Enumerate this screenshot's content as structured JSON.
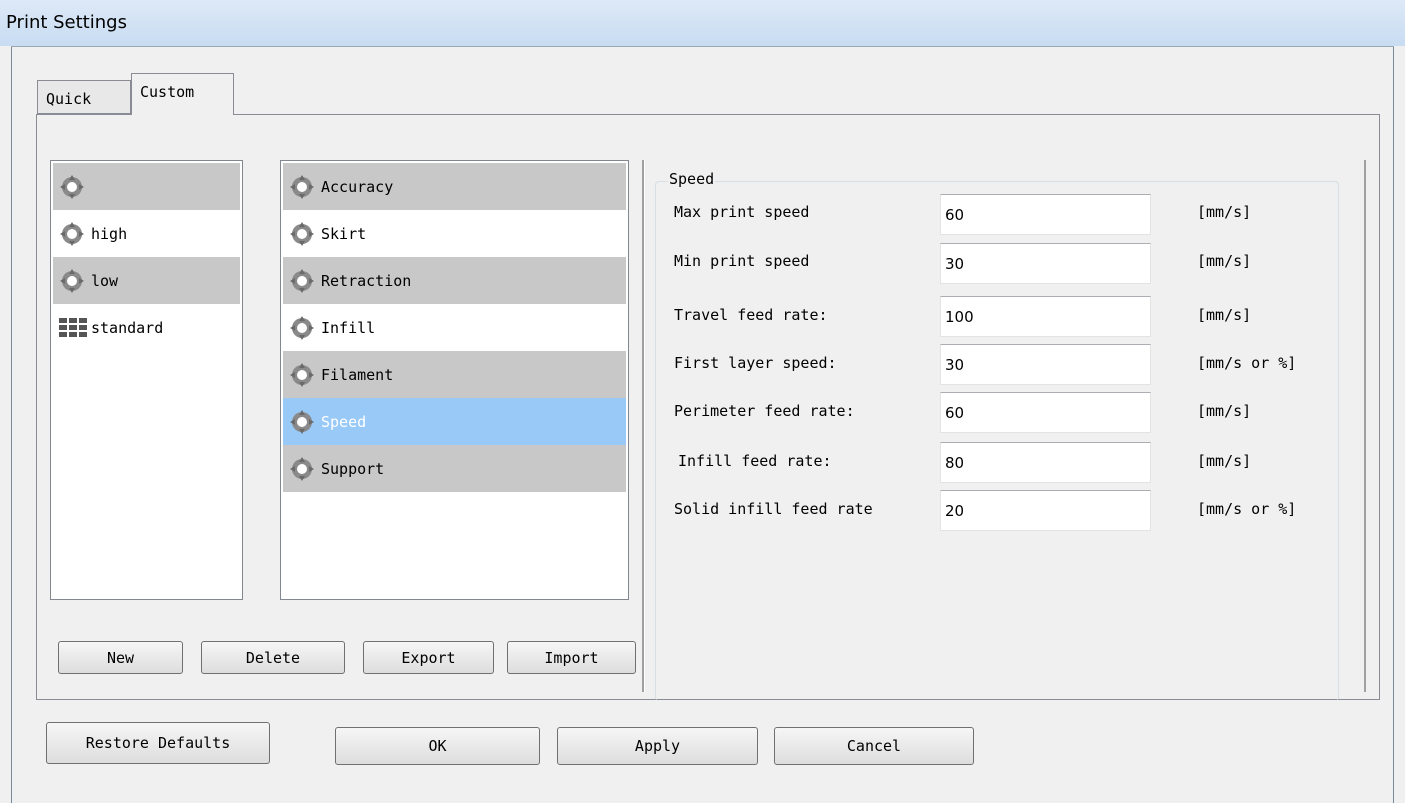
{
  "window": {
    "title": "Print Settings"
  },
  "tabs": [
    {
      "label": "Quick",
      "active": false
    },
    {
      "label": "Custom",
      "active": true
    }
  ],
  "profiles": {
    "items": [
      {
        "label": "",
        "icon": "gear-cross-icon",
        "shaded": true
      },
      {
        "label": "high",
        "icon": "gear-cross-icon",
        "shaded": false
      },
      {
        "label": "low",
        "icon": "gear-cross-icon",
        "shaded": true
      },
      {
        "label": "standard",
        "icon": "grid-icon",
        "shaded": false
      }
    ]
  },
  "categories": {
    "items": [
      {
        "label": "Accuracy",
        "shaded": true,
        "selected": false
      },
      {
        "label": "Skirt",
        "shaded": false,
        "selected": false
      },
      {
        "label": "Retraction",
        "shaded": true,
        "selected": false
      },
      {
        "label": "Infill",
        "shaded": false,
        "selected": false
      },
      {
        "label": "Filament",
        "shaded": true,
        "selected": false
      },
      {
        "label": "Speed",
        "shaded": false,
        "selected": true
      },
      {
        "label": "Support",
        "shaded": true,
        "selected": false
      }
    ]
  },
  "profile_buttons": {
    "new": "New",
    "delete": "Delete",
    "export": "Export",
    "import": "Import"
  },
  "speed": {
    "group_title": "Speed",
    "rows": [
      {
        "label": "Max print speed",
        "value": "60",
        "unit": "[mm/s]"
      },
      {
        "label": "Min print speed",
        "value": "30",
        "unit": "[mm/s]"
      },
      {
        "label": "Travel feed rate:",
        "value": "100",
        "unit": "[mm/s]"
      },
      {
        "label": "First layer speed:",
        "value": "30",
        "unit": "[mm/s or %]"
      },
      {
        "label": "Perimeter feed rate:",
        "value": "60",
        "unit": "[mm/s]"
      },
      {
        "label": "Infill feed rate:",
        "value": "80",
        "unit": "[mm/s]"
      },
      {
        "label": "Solid infill feed rate",
        "value": "20",
        "unit": "[mm/s or %]"
      }
    ]
  },
  "footer": {
    "restore": "Restore Defaults",
    "ok": "OK",
    "apply": "Apply",
    "cancel": "Cancel"
  },
  "colors": {
    "selection": "#99c9f7",
    "shaded_row": "#c8c8c8",
    "titlebar": "#c8dcf2"
  }
}
